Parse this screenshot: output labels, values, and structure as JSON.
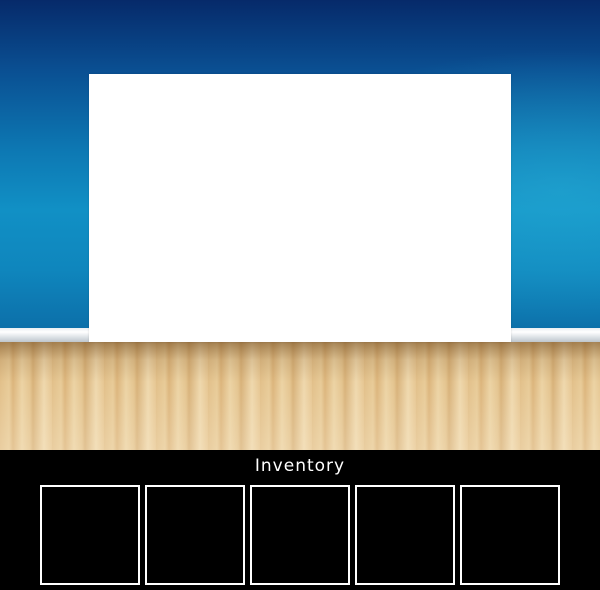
{
  "inventory": {
    "title": "Inventory",
    "slots": [
      {
        "id": 1,
        "item": null
      },
      {
        "id": 2,
        "item": null
      },
      {
        "id": 3,
        "item": null
      },
      {
        "id": 4,
        "item": null
      },
      {
        "id": 5,
        "item": null
      }
    ]
  },
  "scene": {
    "wall_color": "#0d78b3",
    "board_color": "#ffffff",
    "floor_color": "#e6c794"
  }
}
